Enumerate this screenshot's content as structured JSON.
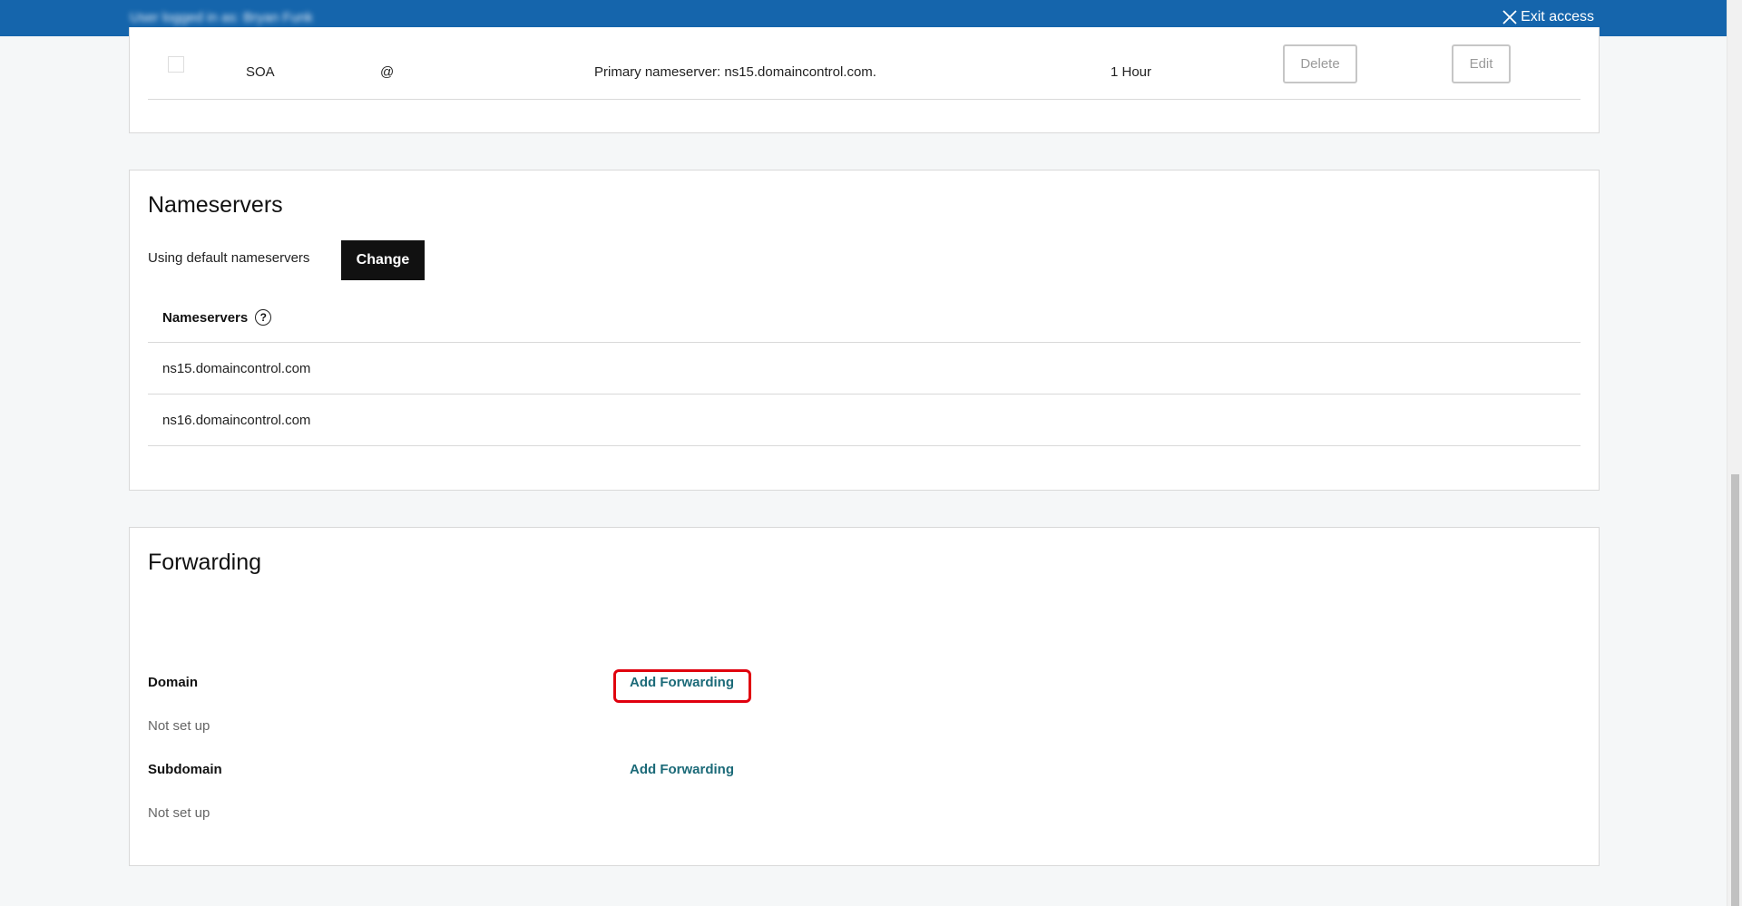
{
  "topbar": {
    "delegate_text": "User logged in as: Bryan Funk",
    "exit_label": "Exit access"
  },
  "dns_record": {
    "type": "SOA",
    "name": "@",
    "value": "Primary nameserver: ns15.domaincontrol.com.",
    "ttl": "1 Hour",
    "delete_label": "Delete",
    "edit_label": "Edit"
  },
  "nameservers": {
    "title": "Nameservers",
    "status_text": "Using default nameservers",
    "change_label": "Change",
    "table_header": "Nameservers",
    "help_icon_glyph": "?",
    "items": [
      "ns15.domaincontrol.com",
      "ns16.domaincontrol.com"
    ]
  },
  "forwarding": {
    "title": "Forwarding",
    "domain_label": "Domain",
    "domain_status": "Not set up",
    "domain_action": "Add Forwarding",
    "subdomain_label": "Subdomain",
    "subdomain_status": "Not set up",
    "subdomain_action": "Add Forwarding"
  },
  "colors": {
    "topbar": "#1565ac",
    "link": "#1b6a78",
    "highlight": "#e0000e"
  }
}
